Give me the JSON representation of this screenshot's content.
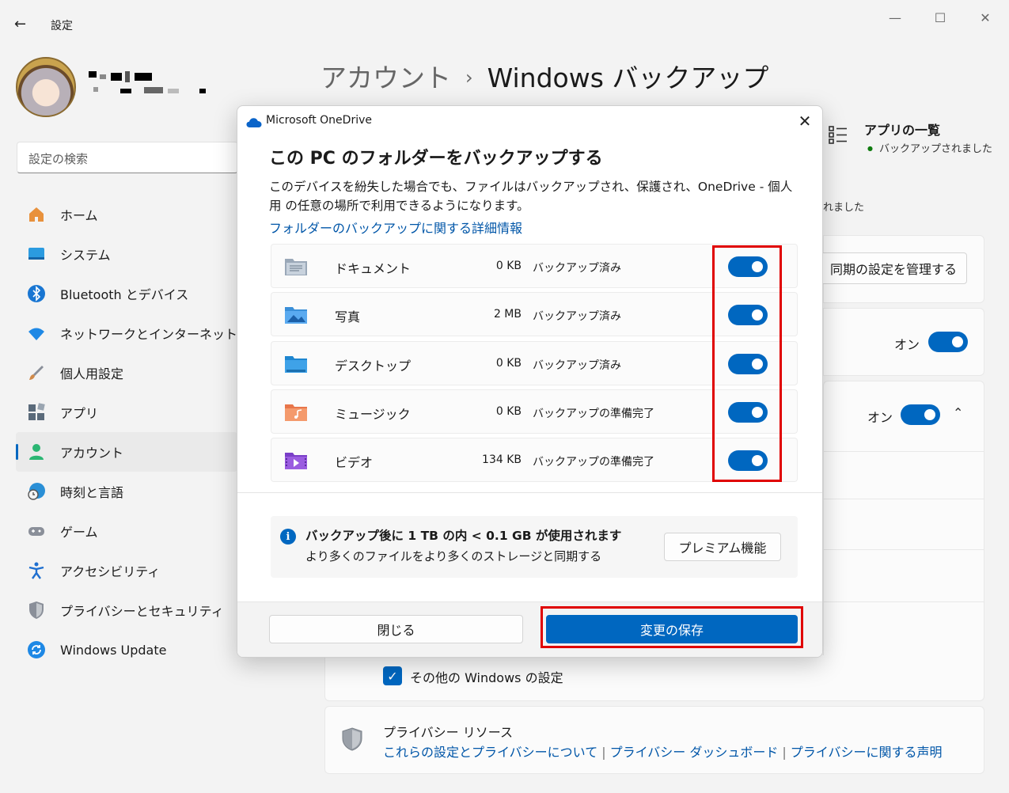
{
  "window": {
    "title": "設定",
    "back_glyph": "←",
    "min_glyph": "—",
    "max_glyph": "☐",
    "close_glyph": "✕"
  },
  "search": {
    "placeholder": "設定の検索"
  },
  "sidebar": {
    "items": [
      {
        "label": "ホーム",
        "icon": "home-icon",
        "color": "#e8913c"
      },
      {
        "label": "システム",
        "icon": "system-icon",
        "color": "#2b9be0"
      },
      {
        "label": "Bluetooth とデバイス",
        "icon": "bluetooth-icon",
        "color": "#1976d2"
      },
      {
        "label": "ネットワークとインターネット",
        "icon": "wifi-icon",
        "color": "#1e88e5"
      },
      {
        "label": "個人用設定",
        "icon": "brush-icon",
        "color": "#d08a4a"
      },
      {
        "label": "アプリ",
        "icon": "apps-icon",
        "color": "#5a6a7a"
      },
      {
        "label": "アカウント",
        "icon": "account-icon",
        "color": "#2bb673",
        "active": true
      },
      {
        "label": "時刻と言語",
        "icon": "globe-clock-icon",
        "color": "#2a8fd6"
      },
      {
        "label": "ゲーム",
        "icon": "gamepad-icon",
        "color": "#8a8f99"
      },
      {
        "label": "アクセシビリティ",
        "icon": "accessibility-icon",
        "color": "#1e6fd0"
      },
      {
        "label": "プライバシーとセキュリティ",
        "icon": "shield-icon",
        "color": "#8a8f99"
      },
      {
        "label": "Windows Update",
        "icon": "update-icon",
        "color": "#1e88e5"
      }
    ]
  },
  "header": {
    "breadcrumb_parent": "アカウント",
    "breadcrumb_sep": "›",
    "breadcrumb_current": "Windows バックアップ"
  },
  "background": {
    "apps_list_title": "アプリの一覧",
    "apps_list_status": "バックアップされました",
    "status_partial": "れました",
    "manage_sync_label": "同期の設定を管理する",
    "toggle1_label": "オン",
    "toggle2_label": "オン",
    "chevron": "⌃",
    "other_settings_label": "その他の Windows の設定",
    "privacy_title": "プライバシー リソース",
    "privacy_links": [
      "これらの設定とプライバシーについて",
      "プライバシー ダッシュボード",
      "プライバシーに関する声明"
    ],
    "link_sep": "|"
  },
  "dialog": {
    "app_title": "Microsoft OneDrive",
    "close_glyph": "✕",
    "heading": "この PC のフォルダーをバックアップする",
    "description": "このデバイスを紛失した場合でも、ファイルはバックアップされ、保護され、OneDrive - 個人用 の任意の場所で利用できるようになります。",
    "learn_more": "フォルダーのバックアップに関する詳細情報",
    "folders": [
      {
        "name": "ドキュメント",
        "size": "0 KB",
        "status": "バックアップ済み",
        "enabled": true,
        "icon": "documents-folder-icon"
      },
      {
        "name": "写真",
        "size": "2 MB",
        "status": "バックアップ済み",
        "enabled": true,
        "icon": "pictures-folder-icon"
      },
      {
        "name": "デスクトップ",
        "size": "0 KB",
        "status": "バックアップ済み",
        "enabled": true,
        "icon": "desktop-folder-icon"
      },
      {
        "name": "ミュージック",
        "size": "0 KB",
        "status": "バックアップの準備完了",
        "enabled": true,
        "icon": "music-folder-icon"
      },
      {
        "name": "ビデオ",
        "size": "134 KB",
        "status": "バックアップの準備完了",
        "enabled": true,
        "icon": "videos-folder-icon"
      }
    ],
    "storage_title": "バックアップ後に 1 TB の内 < 0.1 GB が使用されます",
    "storage_sub": "より多くのファイルをより多くのストレージと同期する",
    "info_glyph": "i",
    "premium_label": "プレミアム機能",
    "close_label": "閉じる",
    "save_label": "変更の保存"
  },
  "colors": {
    "accent": "#0067c0",
    "highlight": "#e00000"
  }
}
